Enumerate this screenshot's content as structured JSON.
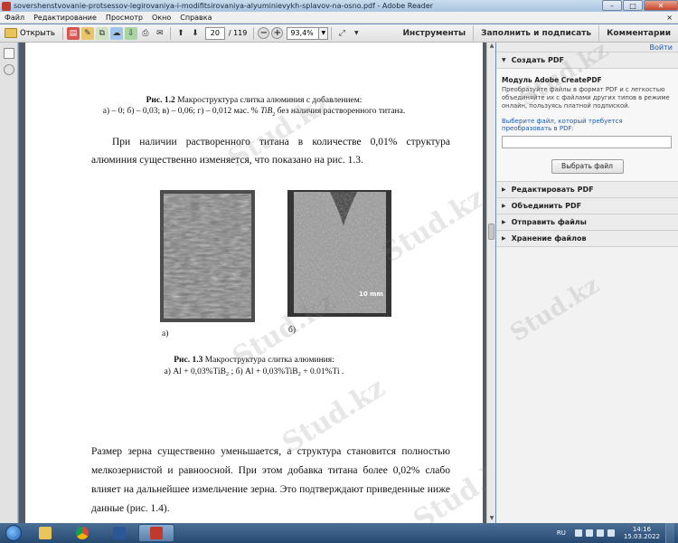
{
  "window": {
    "title": "sovershenstvovanie-protsessov-legirovaniya-i-modifitsirovaniya-alyuminievykh-splavov-na-osno.pdf - Adobe Reader",
    "buttons": {
      "minimize": "–",
      "maximize": "□",
      "close": "✕"
    }
  },
  "menu": {
    "items": [
      "Файл",
      "Редактирование",
      "Просмотр",
      "Окно",
      "Справка"
    ],
    "close": "×"
  },
  "toolbar": {
    "open_label": "Открыть",
    "page_current": "20",
    "page_total": "/ 119",
    "zoom": "93,4%",
    "right_tabs": [
      "Инструменты",
      "Заполнить и подписать",
      "Комментарии"
    ]
  },
  "document": {
    "page1": {
      "fig12_caption_title": "Рис. 1.2",
      "fig12_caption_text": "Макроструктура слитка алюминия с добавлением:",
      "fig12_caption_items": "а) – 0; б) – 0,03; в) – 0,06; г) – 0,012 мас. %",
      "fig12_caption_formula": "TiB",
      "fig12_caption_sub": "2",
      "fig12_caption_tail": "без наличия растворенного титана.",
      "paragraph": "При наличии растворенного титана в количестве 0,01% структура алюминия существенно изменяется, что показано на рис. 1.3.",
      "photo_a_label": "а)",
      "photo_b_label": "б)",
      "scale_label": "10 mm",
      "fig13_caption_title": "Рис. 1.3",
      "fig13_caption_text": "Макроструктура слитка алюминия:",
      "fig13_caption_items": "а)  Al + 0,03%TiB₂ ; б)  Al + 0,03%TiB₂ + 0.01%Ti .",
      "page_number": "20"
    },
    "page2": {
      "paragraph": "Размер зерна существенно уменьшается, а структура становится полностью мелкозернистой и равноосной. При этом добавка титана более 0,02% слабо влияет на дальнейшее измельчение зерна. Это подтверждают приведенные ниже данные (рис. 1.4)."
    },
    "watermark": "Stud.kz"
  },
  "right_panel": {
    "signin": "Войти",
    "create_pdf": {
      "section": "Создать PDF",
      "heading": "Модуль Adobe CreatePDF",
      "description": "Преобразуйте файлы в формат PDF и с легкостью объединяйте их с файлами других типов в режиме онлайн, пользуясь платной подпиской.",
      "file_label": "Выберите файл, который требуется преобразовать в PDF:",
      "button": "Выбрать файл"
    },
    "sections": [
      "Редактировать PDF",
      "Объединить PDF",
      "Отправить файлы",
      "Хранение файлов"
    ]
  },
  "taskbar": {
    "lang": "RU",
    "time": "14:16",
    "date": "15.03.2022"
  }
}
